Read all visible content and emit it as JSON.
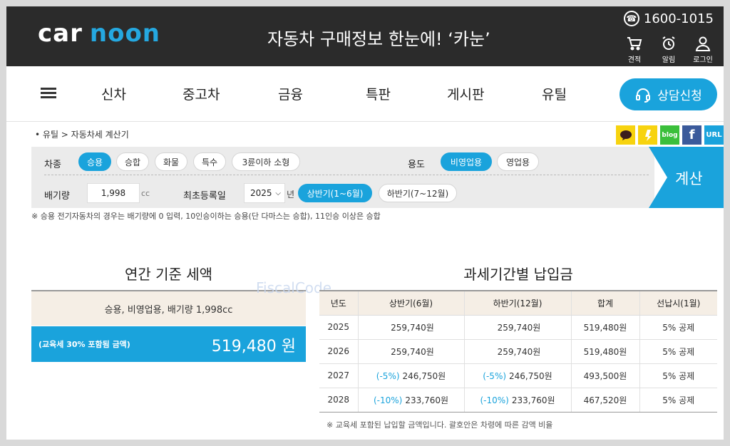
{
  "header": {
    "logo_left": "car",
    "logo_right": "noon",
    "slogan": "자동차 구매정보 한눈에! ‘카눈’",
    "phone": "1600-1015",
    "icons": [
      {
        "label": "견적",
        "icon": "cart-icon"
      },
      {
        "label": "알림",
        "icon": "alarm-icon"
      },
      {
        "label": "로그인",
        "icon": "user-icon"
      }
    ]
  },
  "nav": {
    "items": [
      "신차",
      "중고차",
      "금융",
      "특판",
      "게시판",
      "유틸"
    ],
    "consult_label": "상담신청"
  },
  "breadcrumb": {
    "bullet": "•",
    "path": "유틸 > 자동차세 계산기"
  },
  "share": [
    {
      "icon": "kakaotalk-icon",
      "color": "#f7d30f"
    },
    {
      "icon": "kakaostory-icon",
      "color": "#f7d30f"
    },
    {
      "label": "blog",
      "icon": "blog-icon",
      "color": "#3bbf3b"
    },
    {
      "label": "f",
      "icon": "facebook-icon",
      "color": "#3b5a9b"
    },
    {
      "label": "URL",
      "icon": "url-icon",
      "color": "#1aa3dc"
    }
  ],
  "calc": {
    "vehicle_type_label": "차종",
    "vehicle_types": [
      "승용",
      "승합",
      "화물",
      "특수",
      "3륜이하 소형"
    ],
    "vehicle_type_selected": "승용",
    "usage_label": "용도",
    "usages": [
      "비영업용",
      "영업용"
    ],
    "usage_selected": "비영업용",
    "displacement_label": "배기량",
    "displacement_value": "1,998",
    "displacement_unit": "cc",
    "reg_label": "최초등록일",
    "reg_year": "2025",
    "reg_year_unit": "년",
    "halves": [
      "상반기(1~6월)",
      "하반기(7~12월)"
    ],
    "half_selected": "상반기(1~6월)",
    "calc_button": "계산"
  },
  "note_top": "※ 승용 전기자동차의 경우는 배기량에 0 입력, 10인승이하는 승용(단 다마스는 승합), 11인승 이상은 승합",
  "annual": {
    "title": "연간 기준 세액",
    "summary": "승용, 비영업용, 배기량 1,998cc",
    "edu_note": "(교육세 30% 포함됨 금액)",
    "amount": "519,480 원"
  },
  "watermark": "FiscalCode",
  "period": {
    "title": "과세기간별 납입금",
    "headers": [
      "년도",
      "상반기(6월)",
      "하반기(12월)",
      "합계",
      "선납시(1월)"
    ],
    "rows": [
      {
        "year": "2025",
        "h1_dc": "",
        "h1": "259,740원",
        "h2_dc": "",
        "h2": "259,740원",
        "total": "519,480원",
        "prepay": "5% 공제"
      },
      {
        "year": "2026",
        "h1_dc": "",
        "h1": "259,740원",
        "h2_dc": "",
        "h2": "259,740원",
        "total": "519,480원",
        "prepay": "5% 공제"
      },
      {
        "year": "2027",
        "h1_dc": "(-5%)",
        "h1": "246,750원",
        "h2_dc": "(-5%)",
        "h2": "246,750원",
        "total": "493,500원",
        "prepay": "5% 공제"
      },
      {
        "year": "2028",
        "h1_dc": "(-10%)",
        "h1": "233,760원",
        "h2_dc": "(-10%)",
        "h2": "233,760원",
        "total": "467,520원",
        "prepay": "5% 공제"
      }
    ],
    "note": "※ 교육세 포함된 납입할 금액입니다. 괄호안은 차령에 따른 감액 비율"
  },
  "colors": {
    "accent": "#1aa3dc",
    "dark": "#2b2b2b",
    "beige": "#f5eee5"
  }
}
